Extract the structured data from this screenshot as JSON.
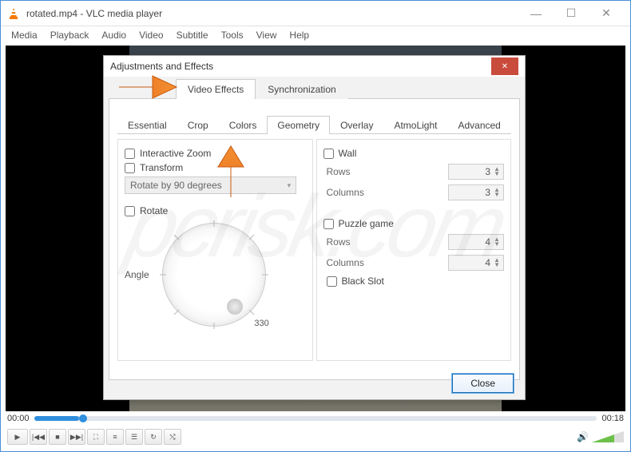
{
  "window": {
    "title": "rotated.mp4 - VLC media player",
    "menu": [
      "Media",
      "Playback",
      "Audio",
      "Video",
      "Subtitle",
      "Tools",
      "View",
      "Help"
    ],
    "time_current": "00:00",
    "time_total": "00:18"
  },
  "dialog": {
    "title": "Adjustments and Effects",
    "tabs": {
      "video_effects": "Video Effects",
      "synchronization": "Synchronization"
    },
    "sub_tabs": {
      "essential": "Essential",
      "crop": "Crop",
      "colors": "Colors",
      "geometry": "Geometry",
      "overlay": "Overlay",
      "atmolight": "AtmoLight",
      "advanced": "Advanced"
    },
    "geometry": {
      "interactive_zoom": "Interactive Zoom",
      "transform": "Transform",
      "transform_value": "Rotate by 90 degrees",
      "rotate": "Rotate",
      "angle": "Angle",
      "angle_value": "330",
      "wall": "Wall",
      "rows": "Rows",
      "columns": "Columns",
      "wall_rows_value": "3",
      "wall_cols_value": "3",
      "puzzle": "Puzzle game",
      "puzzle_rows_value": "4",
      "puzzle_cols_value": "4",
      "black_slot": "Black Slot"
    },
    "close": "Close"
  },
  "watermark": "pcrisk.com"
}
